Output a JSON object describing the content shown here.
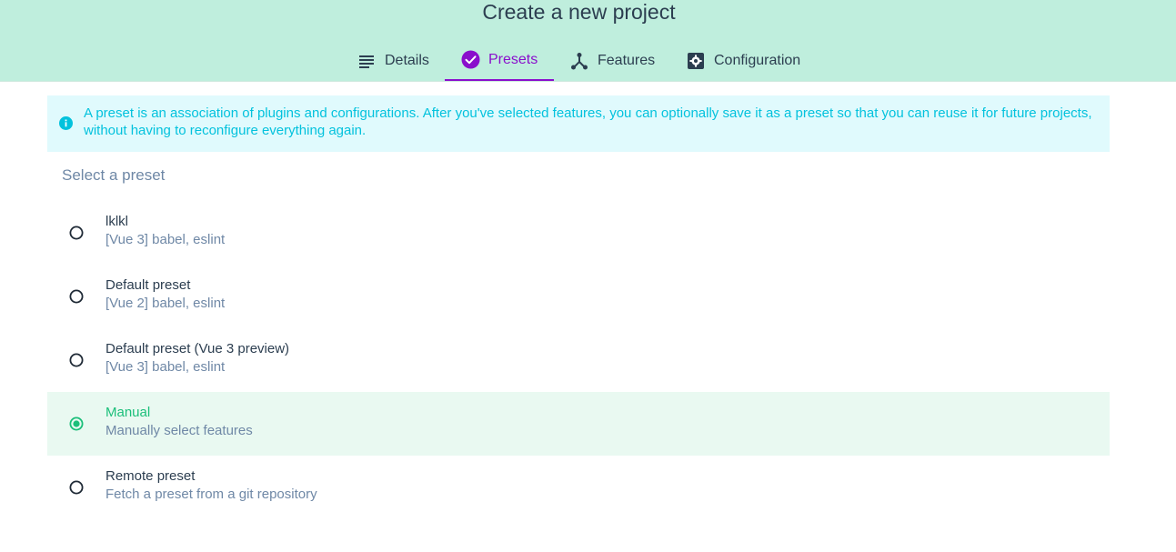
{
  "header": {
    "title": "Create a new project",
    "tabs": [
      {
        "label": "Details",
        "icon": "list-icon"
      },
      {
        "label": "Presets",
        "icon": "check-circle-icon",
        "active": true
      },
      {
        "label": "Features",
        "icon": "merge-icon"
      },
      {
        "label": "Configuration",
        "icon": "settings-box-icon"
      }
    ]
  },
  "info": {
    "icon": "info-icon",
    "text": "A preset is an association of plugins and configurations. After you've selected features, you can optionally save it as a preset so that you can reuse it for future projects, without having to reconfigure everything again."
  },
  "section_title": "Select a preset",
  "presets": [
    {
      "name": "lklkl",
      "description": "[Vue 3] babel, eslint",
      "selected": false
    },
    {
      "name": "Default preset",
      "description": "[Vue 2] babel, eslint",
      "selected": false
    },
    {
      "name": "Default preset (Vue 3 preview)",
      "description": "[Vue 3] babel, eslint",
      "selected": false
    },
    {
      "name": "Manual",
      "description": "Manually select features",
      "selected": true
    },
    {
      "name": "Remote preset",
      "description": "Fetch a preset from a git repository",
      "selected": false
    }
  ],
  "colors": {
    "header_bg": "#bfeedd",
    "accent_purple": "#8a0fcc",
    "info_bg": "#e0fafd",
    "info_text": "#03c2dd",
    "selected_bg": "#e9f9f1",
    "selected_green": "#1bbf7a",
    "text_dark": "#2c3e50",
    "text_muted": "#6f88a6"
  }
}
